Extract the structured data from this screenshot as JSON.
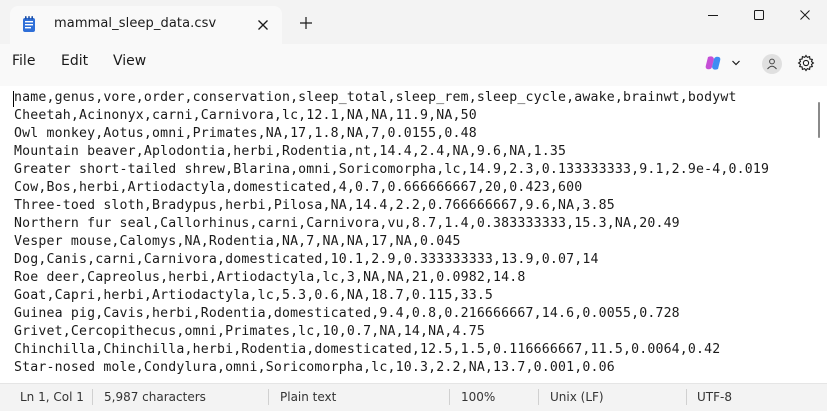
{
  "tab": {
    "title": "mammal_sleep_data.csv"
  },
  "menu": {
    "file": "File",
    "edit": "Edit",
    "view": "View"
  },
  "colors": {
    "copilot_a": "#c54fd6",
    "copilot_b": "#3f8cf3",
    "notepad_icon": "#2f6fd8"
  },
  "lines": [
    "name,genus,vore,order,conservation,sleep_total,sleep_rem,sleep_cycle,awake,brainwt,bodywt",
    "Cheetah,Acinonyx,carni,Carnivora,lc,12.1,NA,NA,11.9,NA,50",
    "Owl monkey,Aotus,omni,Primates,NA,17,1.8,NA,7,0.0155,0.48",
    "Mountain beaver,Aplodontia,herbi,Rodentia,nt,14.4,2.4,NA,9.6,NA,1.35",
    "Greater short-tailed shrew,Blarina,omni,Soricomorpha,lc,14.9,2.3,0.133333333,9.1,2.9e-4,0.019",
    "Cow,Bos,herbi,Artiodactyla,domesticated,4,0.7,0.666666667,20,0.423,600",
    "Three-toed sloth,Bradypus,herbi,Pilosa,NA,14.4,2.2,0.766666667,9.6,NA,3.85",
    "Northern fur seal,Callorhinus,carni,Carnivora,vu,8.7,1.4,0.383333333,15.3,NA,20.49",
    "Vesper mouse,Calomys,NA,Rodentia,NA,7,NA,NA,17,NA,0.045",
    "Dog,Canis,carni,Carnivora,domesticated,10.1,2.9,0.333333333,13.9,0.07,14",
    "Roe deer,Capreolus,herbi,Artiodactyla,lc,3,NA,NA,21,0.0982,14.8",
    "Goat,Capri,herbi,Artiodactyla,lc,5.3,0.6,NA,18.7,0.115,33.5",
    "Guinea pig,Cavis,herbi,Rodentia,domesticated,9.4,0.8,0.216666667,14.6,0.0055,0.728",
    "Grivet,Cercopithecus,omni,Primates,lc,10,0.7,NA,14,NA,4.75",
    "Chinchilla,Chinchilla,herbi,Rodentia,domesticated,12.5,1.5,0.116666667,11.5,0.0064,0.42",
    "Star-nosed mole,Condylura,omni,Soricomorpha,lc,10.3,2.2,NA,13.7,0.001,0.06"
  ],
  "status": {
    "position": "Ln 1, Col 1",
    "characters": "5,987 characters",
    "format": "Plain text",
    "zoom": "100%",
    "line_ending": "Unix (LF)",
    "encoding": "UTF-8"
  }
}
